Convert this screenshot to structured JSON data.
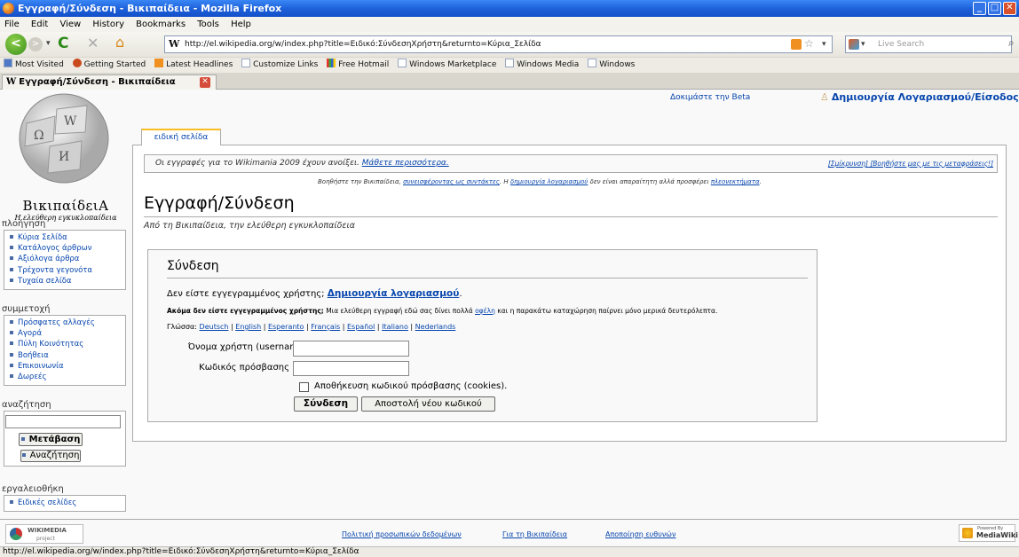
{
  "window": {
    "title": "Εγγραφή/Σύνδεση - Βικιπαίδεια - Mozilla Firefox"
  },
  "menu": [
    "File",
    "Edit",
    "View",
    "History",
    "Bookmarks",
    "Tools",
    "Help"
  ],
  "navbar": {
    "url": "http://el.wikipedia.org/w/index.php?title=Ειδικό:ΣύνδεσηΧρήστη&returnto=Κύρια_Σελίδα",
    "search_placeholder": "Live Search"
  },
  "bookmarks": [
    "Most Visited",
    "Getting Started",
    "Latest Headlines",
    "Customize Links",
    "Free Hotmail",
    "Windows Marketplace",
    "Windows Media",
    "Windows"
  ],
  "tab": {
    "label": "Εγγραφή/Σύνδεση - Βικιπαίδεια"
  },
  "personal": {
    "beta": "Δοκιμάστε την Beta",
    "login": "Δημιουργία Λογαριασμού/Είσοδος"
  },
  "logo": {
    "name": "ΒικιπαίδειΑ",
    "tagline": "Η ελεύθερη εγκυκλοπαίδεια"
  },
  "special_tab": "ειδική σελίδα",
  "sitenotice": {
    "text": "Οι εγγραφές για το Wikimania 2009 έχουν ανοίξει.",
    "link": "Μάθετε περισσότερα.",
    "right_links": "[Σμίκρυνση] [Βοηθήστε μας με τις μεταφράσεις!]",
    "sub_a": "Βοηθήστε την Βικιπαίδεια,",
    "sub_link1": "συνεισφέροντας ως συντάκτες",
    "sub_b": ". Η",
    "sub_link2": "δημιουργία λογαριασμού",
    "sub_c": "δεν είναι απαραίτητη αλλά προσφέρει",
    "sub_link3": "πλεονεκτήματα",
    "sub_d": "."
  },
  "heading": {
    "title": "Εγγραφή/Σύνδεση",
    "subtitle": "Από τη Βικιπαίδεια, την ελεύθερη εγκυκλοπαίδεια"
  },
  "sidebar": {
    "nav_title": "πλοήγηση",
    "nav_items": [
      "Κύρια Σελίδα",
      "Κατάλογος άρθρων",
      "Αξιόλογα άρθρα",
      "Τρέχοντα γεγονότα",
      "Τυχαία σελίδα"
    ],
    "participate_title": "συμμετοχή",
    "participate_items": [
      "Πρόσφατες αλλαγές",
      "Αγορά",
      "Πύλη Κοινότητας",
      "Βοήθεια",
      "Επικοινωνία",
      "Δωρεές"
    ],
    "search_title": "αναζήτηση",
    "go_button": "Μετάβαση",
    "search_button": "Αναζήτηση",
    "toolbox_title": "εργαλειοθήκη",
    "toolbox_items": [
      "Ειδικές σελίδες"
    ]
  },
  "login": {
    "legend": "Σύνδεση",
    "not_registered": "Δεν είστε εγγεγραμμένος χρήστης;",
    "create_account": "Δημιουργία λογαριασμού",
    "create_account_end": ".",
    "still_bold": "Ακόμα δεν είστε εγγεγραμμένος χρήστης;",
    "still_text": "Μια ελεύθερη εγγραφή εδώ σας δίνει πολλά",
    "benefits_link": "οφέλη",
    "still_end": "και η παρακάτω καταχώρηση παίρνει μόνο μερικά δευτερόλεπτα.",
    "language_label": "Γλώσσα:",
    "languages": [
      "Deutsch",
      "English",
      "Esperanto",
      "Français",
      "Español",
      "Italiano",
      "Nederlands"
    ],
    "username_label": "Όνομα χρήστη (username)",
    "password_label": "Κωδικός πρόσβασης",
    "remember_label": "Αποθήκευση κωδικού πρόσβασης (cookies).",
    "login_button": "Σύνδεση",
    "mail_password_button": "Αποστολή νέου κωδικού"
  },
  "footer": {
    "wikimedia": "WIKIMEDIA",
    "wikimedia_sub": "project",
    "links": [
      "Πολιτική προσωπικών δεδομένων",
      "Για τη Βικιπαίδεια",
      "Αποποίηση ευθυνών"
    ],
    "mediawiki_small": "Powered By",
    "mediawiki": "MediaWiki"
  },
  "status_text": "http://el.wikipedia.org/w/index.php?title=Ειδικό:ΣύνδεσηΧρήστη&returnto=Κύρια_Σελίδα",
  "colors": {
    "link": "#0645ad",
    "titlebar": "#1c5fd8",
    "border": "#aaaaaa"
  }
}
